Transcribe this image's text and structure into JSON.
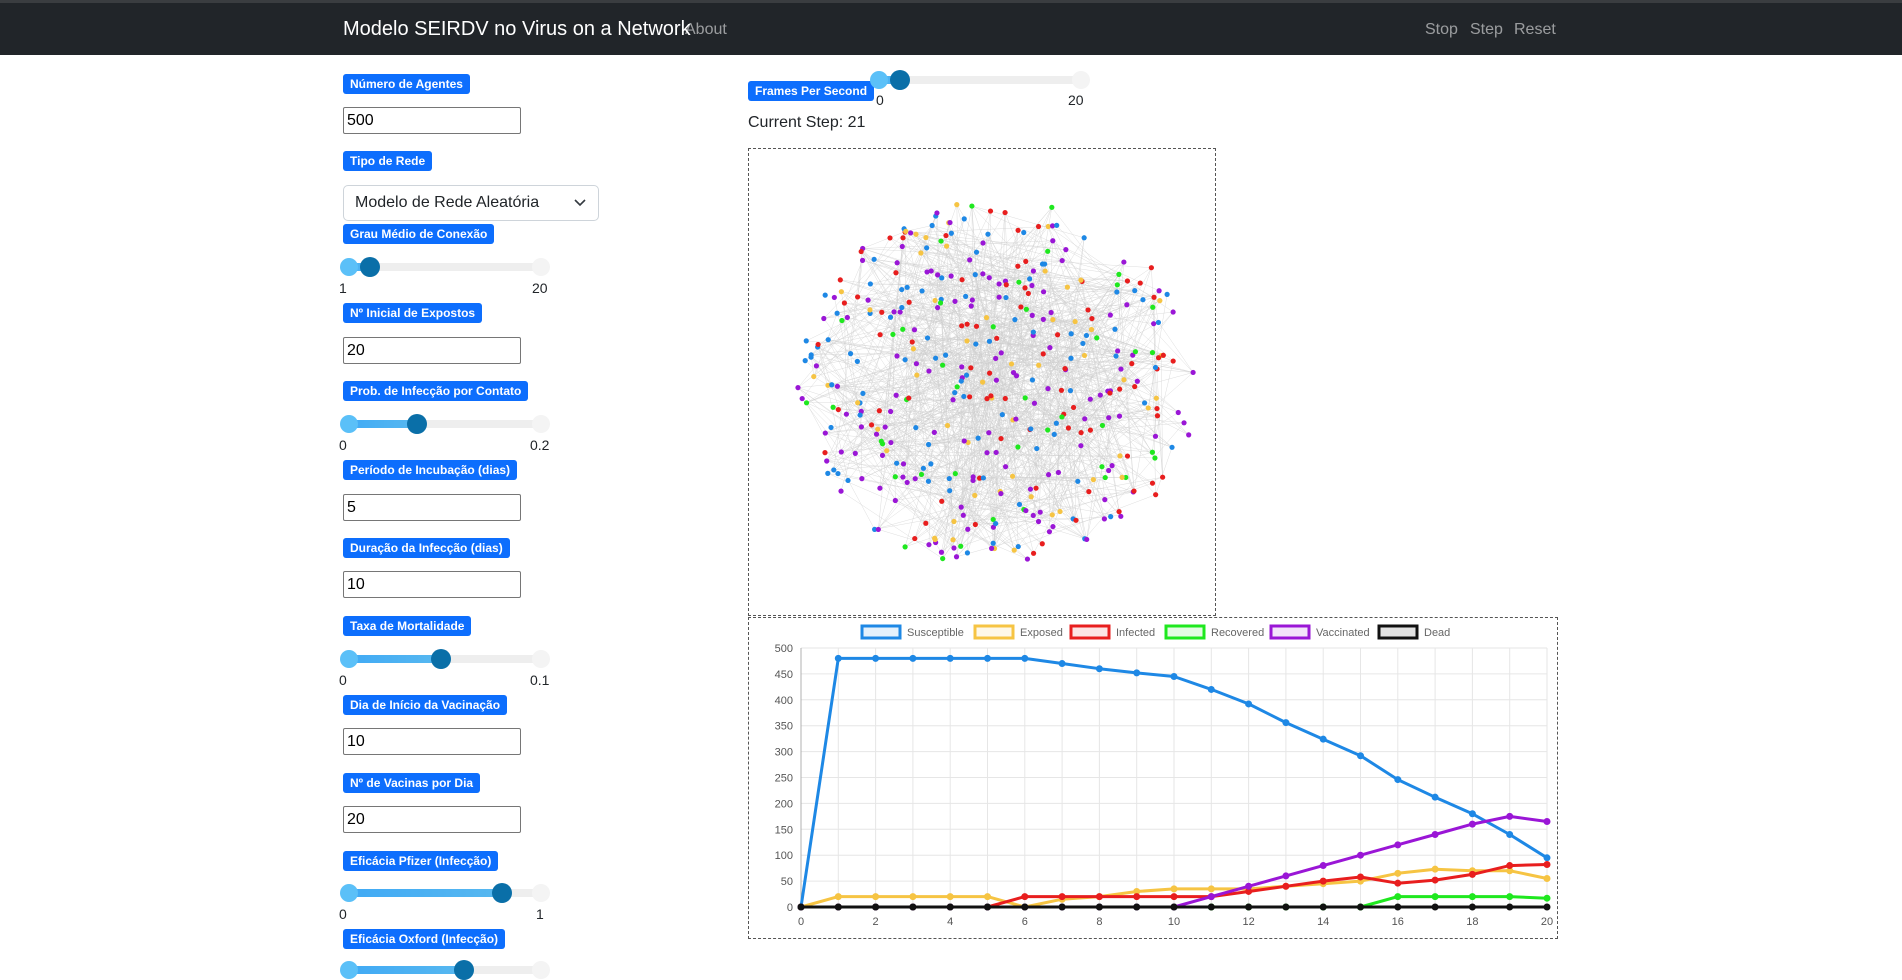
{
  "navbar": {
    "brand": "Modelo SEIRDV no Virus on a Network",
    "about": "About",
    "stop": "Stop",
    "step": "Step",
    "reset": "Reset"
  },
  "controls": {
    "num_agents": {
      "label": "Número de Agentes",
      "value": "500"
    },
    "network_type": {
      "label": "Tipo de Rede",
      "selected": "Modelo de Rede Aleatória"
    },
    "avg_degree": {
      "label": "Grau Médio de Conexão",
      "min": "1",
      "max": "20",
      "value": 3
    },
    "initial_exposed": {
      "label": "Nº Inicial de Expostos",
      "value": "20"
    },
    "infection_prob": {
      "label": "Prob. de Infecção por Contato",
      "min": "0",
      "max": "0.2",
      "value": 0.07
    },
    "incubation": {
      "label": "Período de Incubação (dias)",
      "value": "5"
    },
    "infection_duration": {
      "label": "Duração da Infecção (dias)",
      "value": "10"
    },
    "mortality": {
      "label": "Taxa de Mortalidade",
      "min": "0",
      "max": "0.1",
      "value": 0.048
    },
    "vaccination_start": {
      "label": "Dia de Início da Vacinação",
      "value": "10"
    },
    "vaccines_per_day": {
      "label": "Nº de Vacinas por Dia",
      "value": "20"
    },
    "pfizer_efficacy": {
      "label": "Eficácia Pfizer (Infecção)",
      "min": "0",
      "max": "1",
      "value": 0.8
    },
    "oxford_efficacy": {
      "label": "Eficácia Oxford (Infecção)",
      "value": 0.6
    }
  },
  "fps": {
    "label": "Frames Per Second",
    "min": "0",
    "max": "20",
    "value": 2
  },
  "current_step": "Current Step: 21",
  "colors": {
    "Susceptible": "#1e88e5",
    "Exposed": "#f6c443",
    "Infected": "#e81e1e",
    "Recovered": "#1fe81f",
    "Vaccinated": "#9a16d6",
    "Dead": "#111111"
  },
  "network": {
    "node_count_shown": 420
  },
  "chart_data": {
    "type": "line",
    "x": [
      0,
      1,
      2,
      3,
      4,
      5,
      6,
      7,
      8,
      9,
      10,
      11,
      12,
      13,
      14,
      15,
      16,
      17,
      18,
      19,
      20
    ],
    "ylim": [
      0,
      500
    ],
    "yticks": [
      0,
      50,
      100,
      150,
      200,
      250,
      300,
      350,
      400,
      450,
      500
    ],
    "xticks": [
      0,
      2,
      4,
      6,
      8,
      10,
      12,
      14,
      16,
      18,
      20
    ],
    "legend_position": "top",
    "grid": true,
    "series": [
      {
        "name": "Susceptible",
        "values": [
          0,
          480,
          480,
          480,
          480,
          480,
          480,
          470,
          460,
          452,
          445,
          420,
          392,
          356,
          324,
          292,
          246,
          212,
          180,
          140,
          95
        ]
      },
      {
        "name": "Exposed",
        "values": [
          0,
          20,
          20,
          20,
          20,
          20,
          0,
          15,
          20,
          30,
          35,
          35,
          35,
          40,
          45,
          50,
          65,
          73,
          70,
          70,
          55
        ]
      },
      {
        "name": "Infected",
        "values": [
          0,
          0,
          0,
          0,
          0,
          0,
          20,
          20,
          20,
          20,
          20,
          20,
          30,
          40,
          50,
          58,
          46,
          52,
          63,
          80,
          82
        ]
      },
      {
        "name": "Recovered",
        "values": [
          0,
          0,
          0,
          0,
          0,
          0,
          0,
          0,
          0,
          0,
          0,
          0,
          0,
          0,
          0,
          0,
          20,
          20,
          20,
          20,
          17
        ]
      },
      {
        "name": "Vaccinated",
        "values": [
          0,
          0,
          0,
          0,
          0,
          0,
          0,
          0,
          0,
          0,
          0,
          20,
          40,
          60,
          80,
          100,
          120,
          140,
          160,
          175,
          165
        ]
      },
      {
        "name": "Dead",
        "values": [
          0,
          0,
          0,
          0,
          0,
          0,
          0,
          0,
          0,
          0,
          0,
          0,
          0,
          0,
          0,
          0,
          0,
          0,
          0,
          0,
          0
        ]
      }
    ]
  }
}
